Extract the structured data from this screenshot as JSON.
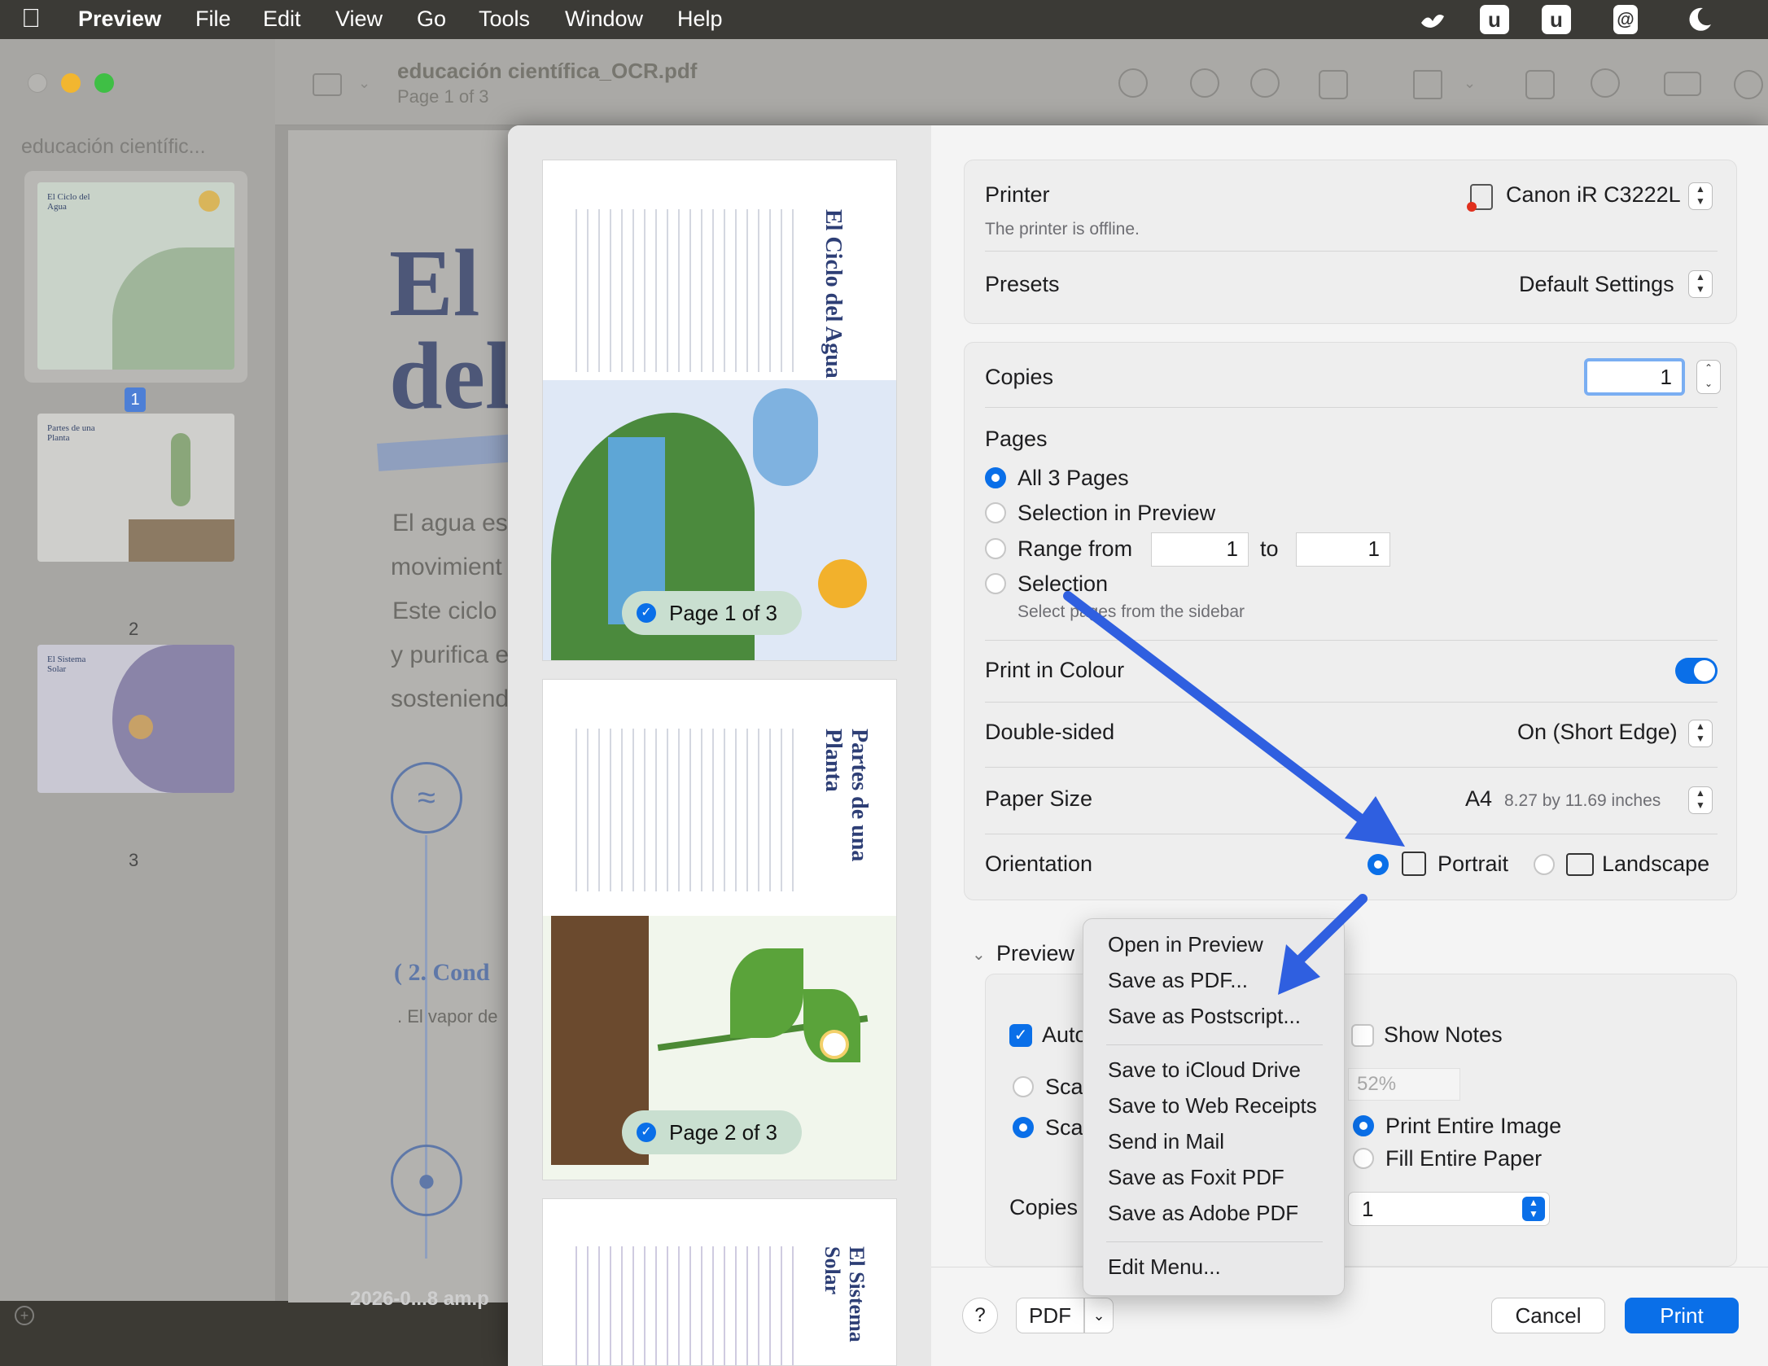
{
  "menubar": {
    "app_name": "Preview",
    "items": [
      "File",
      "Edit",
      "View",
      "Go",
      "Tools",
      "Window",
      "Help"
    ],
    "tray_icons": [
      "bird-icon",
      "u-app-icon",
      "u-app-icon",
      "at-icon",
      "moon-icon"
    ]
  },
  "window": {
    "title": "educación científica_OCR.pdf",
    "subtitle": "Page 1 of 3",
    "sidebar_title": "educación científic...",
    "thumbnails": [
      {
        "num": "1",
        "title": "El Ciclo del Agua"
      },
      {
        "num": "2",
        "title": "Partes de una Planta"
      },
      {
        "num": "3",
        "title": "El Sistema Solar"
      }
    ],
    "doc_fragments": {
      "heading_line1": "El",
      "heading_line2": "del",
      "para1": "El agua es",
      "para2": "movimient",
      "para3": "Este ciclo",
      "para4": "y purifica e",
      "para5": "sosteniend",
      "step2": "( 2. Cond",
      "vapor": ". El vapor de",
      "bottom_label": "2026-0...8 am.p"
    }
  },
  "print_dialog": {
    "preview_pages": [
      {
        "label": "Page 1 of 3",
        "title": "El Ciclo del Agua"
      },
      {
        "label": "Page 2 of 3",
        "title": "Partes de una Planta"
      },
      {
        "label": "",
        "title": "El Sistema Solar"
      }
    ],
    "printer": {
      "label": "Printer",
      "value": "Canon iR C3222L",
      "status": "The printer is offline."
    },
    "presets": {
      "label": "Presets",
      "value": "Default Settings"
    },
    "copies": {
      "label": "Copies",
      "value": "1"
    },
    "pages": {
      "label": "Pages",
      "options": [
        "All 3 Pages",
        "Selection in Preview",
        "Range from",
        "Selection"
      ],
      "range_from": "1",
      "range_to_label": "to",
      "range_to": "1",
      "selection_hint": "Select pages from the sidebar"
    },
    "print_in_colour": {
      "label": "Print in Colour",
      "on": true
    },
    "double_sided": {
      "label": "Double-sided",
      "value": "On (Short Edge)"
    },
    "paper_size": {
      "label": "Paper Size",
      "value": "A4",
      "detail": "8.27 by 11.69 inches"
    },
    "orientation": {
      "label": "Orientation",
      "portrait": "Portrait",
      "landscape": "Landscape"
    },
    "preview_section": {
      "label": "Preview",
      "auto": "Auto",
      "scale_a": "Scal",
      "scale_b": "Scal",
      "show_notes": "Show Notes",
      "scale_value": "52%",
      "print_entire_image": "Print Entire Image",
      "fill_entire_paper": "Fill Entire Paper",
      "copies_label": "Copies",
      "copies_value": "1"
    },
    "footer": {
      "help": "?",
      "pdf": "PDF",
      "cancel": "Cancel",
      "print": "Print"
    },
    "pdf_menu": {
      "group1": [
        "Open in Preview",
        "Save as PDF...",
        "Save as Postscript..."
      ],
      "group2": [
        "Save to iCloud Drive",
        "Save to Web Receipts",
        "Send in Mail",
        "Save as Foxit PDF",
        "Save as Adobe PDF"
      ],
      "group3": [
        "Edit Menu..."
      ]
    }
  },
  "colors": {
    "accent": "#0a6fe8",
    "arrow": "#2f5fe0",
    "menubar": "#3b3a36"
  }
}
